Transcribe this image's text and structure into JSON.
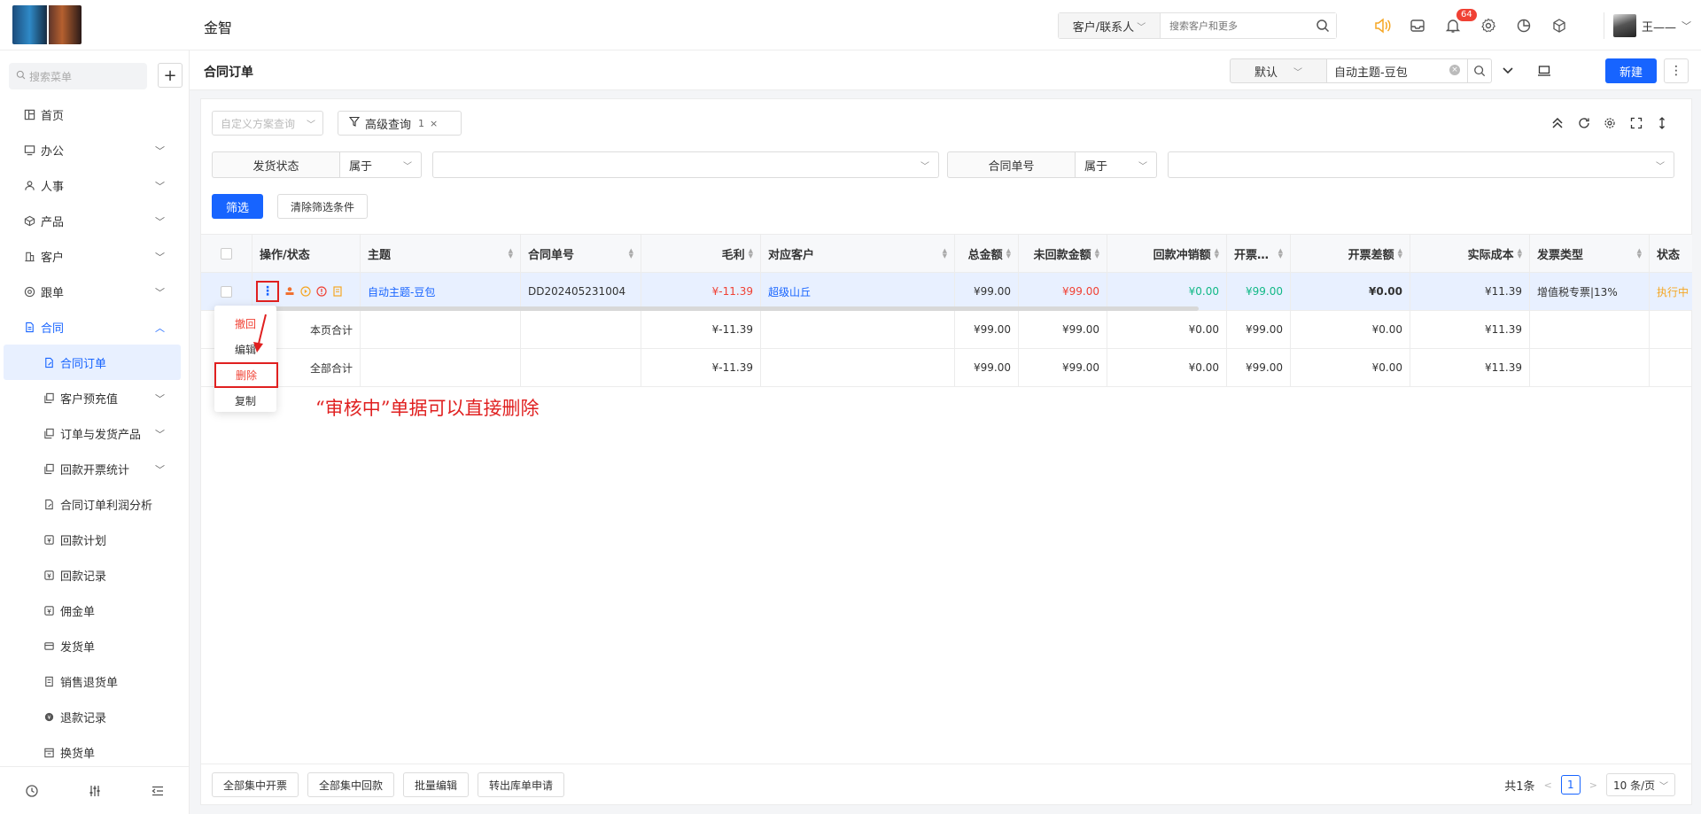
{
  "app": {
    "title": "金智"
  },
  "header": {
    "search_scope": "客户/联系人",
    "search_placeholder": "搜索客户和更多",
    "notification_count": "64",
    "user_name": "王——"
  },
  "sidebar": {
    "search_placeholder": "搜索菜单",
    "add_label": "+",
    "items": [
      {
        "label": "首页"
      },
      {
        "label": "办公"
      },
      {
        "label": "人事"
      },
      {
        "label": "产品"
      },
      {
        "label": "客户"
      },
      {
        "label": "跟单"
      },
      {
        "label": "合同"
      }
    ],
    "sub_items": [
      {
        "label": "合同订单"
      },
      {
        "label": "客户预充值"
      },
      {
        "label": "订单与发货产品"
      },
      {
        "label": "回款开票统计"
      },
      {
        "label": "合同订单利润分析"
      },
      {
        "label": "回款计划"
      },
      {
        "label": "回款记录"
      },
      {
        "label": "佣金单"
      },
      {
        "label": "发货单"
      },
      {
        "label": "销售退货单"
      },
      {
        "label": "退款记录"
      },
      {
        "label": "换货单"
      }
    ]
  },
  "page": {
    "title": "合同订单",
    "view_select": "默认",
    "view_search_value": "自动主题-豆包",
    "new_label": "新建"
  },
  "filters": {
    "scheme_placeholder": "自定义方案查询",
    "advanced_label": "高级查询",
    "advanced_count": "1",
    "advanced_clear": "×",
    "row1": {
      "label": "发货状态",
      "op": "属于"
    },
    "row2": {
      "label": "合同单号",
      "op": "属于"
    },
    "apply_label": "筛选",
    "clear_label": "清除筛选条件"
  },
  "table": {
    "columns": [
      "操作/状态",
      "主题",
      "合同单号",
      "毛利",
      "对应客户",
      "总金额",
      "未回款金额",
      "回款冲销额",
      "开票…",
      "开票差额",
      "实际成本",
      "发票类型",
      "状态"
    ],
    "row": {
      "subject": "自动主题-豆包",
      "contract_no": "DD202405231004",
      "profit": "¥-11.39",
      "customer": "超级山丘",
      "total": "¥99.00",
      "unpaid": "¥99.00",
      "writeoff": "¥0.00",
      "invoiced": "¥99.00",
      "invoice_diff": "¥0.00",
      "actual_cost": "¥11.39",
      "invoice_type": "增值税专票|13%",
      "status": "执行中"
    },
    "page_total": {
      "label": "本页合计",
      "profit": "¥-11.39",
      "total": "¥99.00",
      "unpaid": "¥99.00",
      "writeoff": "¥0.00",
      "invoiced": "¥99.00",
      "invoice_diff": "¥0.00",
      "actual_cost": "¥11.39"
    },
    "all_total": {
      "label": "全部合计",
      "profit": "¥-11.39",
      "total": "¥99.00",
      "unpaid": "¥99.00",
      "writeoff": "¥0.00",
      "invoiced": "¥99.00",
      "invoice_diff": "¥0.00",
      "actual_cost": "¥11.39"
    }
  },
  "dropdown": {
    "items": [
      "撤回",
      "编辑",
      "删除",
      "复制"
    ]
  },
  "annotation": "“审核中”单据可以直接删除",
  "footer": {
    "buttons": [
      "全部集中开票",
      "全部集中回款",
      "批量编辑",
      "转出库单申请"
    ],
    "total_label": "共1条",
    "current_page": "1",
    "page_size": "10 条/页"
  },
  "colors": {
    "accent": "#1764ff",
    "danger": "#f04134",
    "success": "#11b887",
    "warning": "#f5a623"
  }
}
